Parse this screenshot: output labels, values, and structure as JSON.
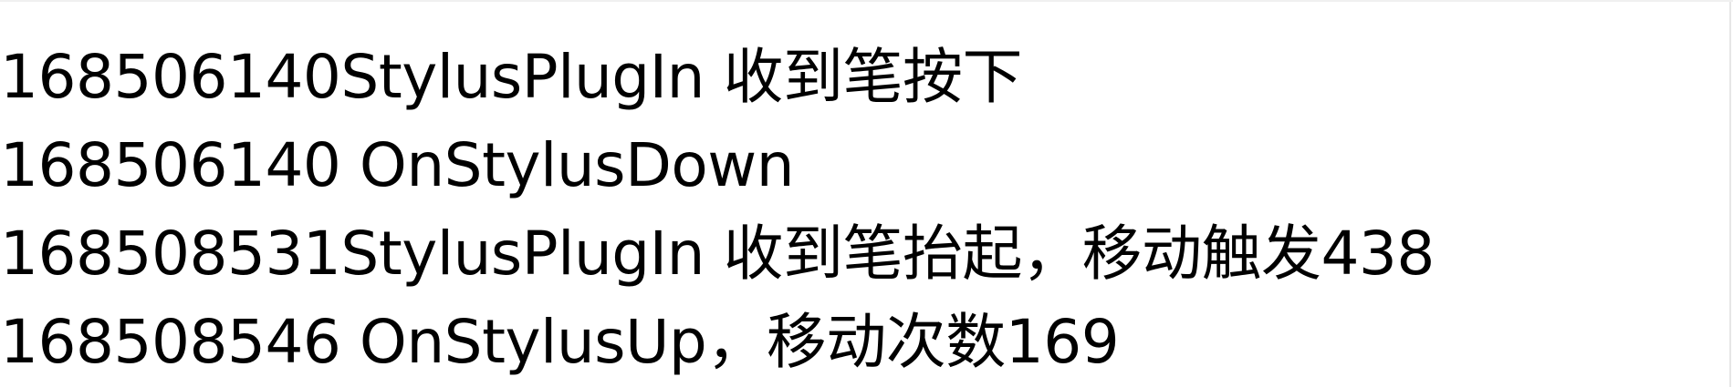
{
  "log": {
    "lines": [
      "168506140StylusPlugIn 收到笔按下",
      "168506140 OnStylusDown",
      "168508531StylusPlugIn 收到笔抬起，移动触发438",
      "168508546 OnStylusUp，移动次数169"
    ]
  }
}
